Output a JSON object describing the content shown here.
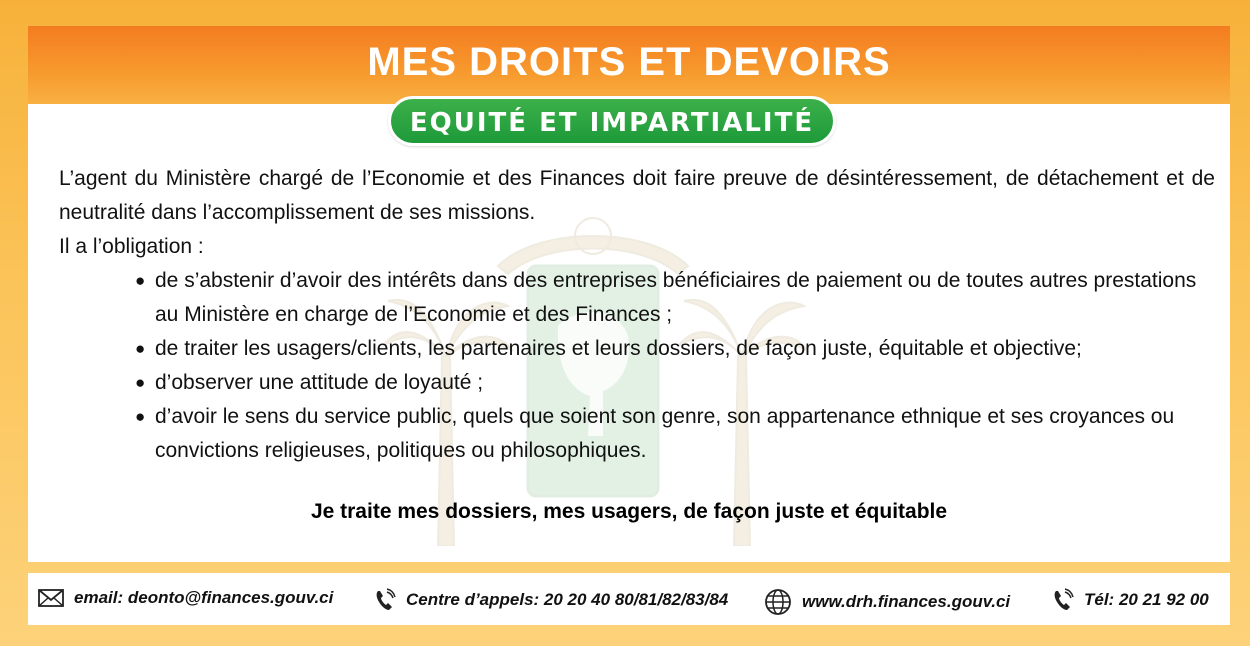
{
  "header": {
    "title": "MES DROITS ET DEVOIRS",
    "subtitle": "EQUITÉ ET IMPARTIALITÉ"
  },
  "content": {
    "intro": "L’agent du Ministère chargé de l’Economie et des Finances doit faire preuve de désintéressement, de détachement et de neutralité dans l’accomplissement de ses missions.",
    "obligation_label": "Il a l’obligation :",
    "bullets": [
      "de s’abstenir d’avoir des intérêts dans des entreprises bénéficiaires de paiement ou de toutes autres prestations au Ministère en charge de l’Economie et des Finances ;",
      "de traiter les usagers/clients, les partenaires et leurs dossiers, de façon juste, équitable et objective;",
      "d’observer une attitude de loyauté ;",
      "d’avoir le sens du service public, quels que soient son genre, son appartenance ethnique et ses croyances ou convictions religieuses, politiques ou philosophiques."
    ],
    "tagline": "Je traite mes dossiers, mes usagers, de façon juste et équitable"
  },
  "footer": {
    "email": "email: deonto@finances.gouv.ci",
    "call_center": "Centre d’appels: 20 20 40 80/81/82/83/84",
    "website": "www.drh.finances.gouv.ci",
    "phone": "Tél: 20 21 92 00"
  },
  "icons": {
    "email": "envelope-icon",
    "call_center": "phone-icon",
    "website": "globe-icon",
    "phone": "phone-icon"
  },
  "colors": {
    "header_orange": "#f47c20",
    "pill_green": "#1e9a3a",
    "background_yellow": "#fbc45a"
  }
}
